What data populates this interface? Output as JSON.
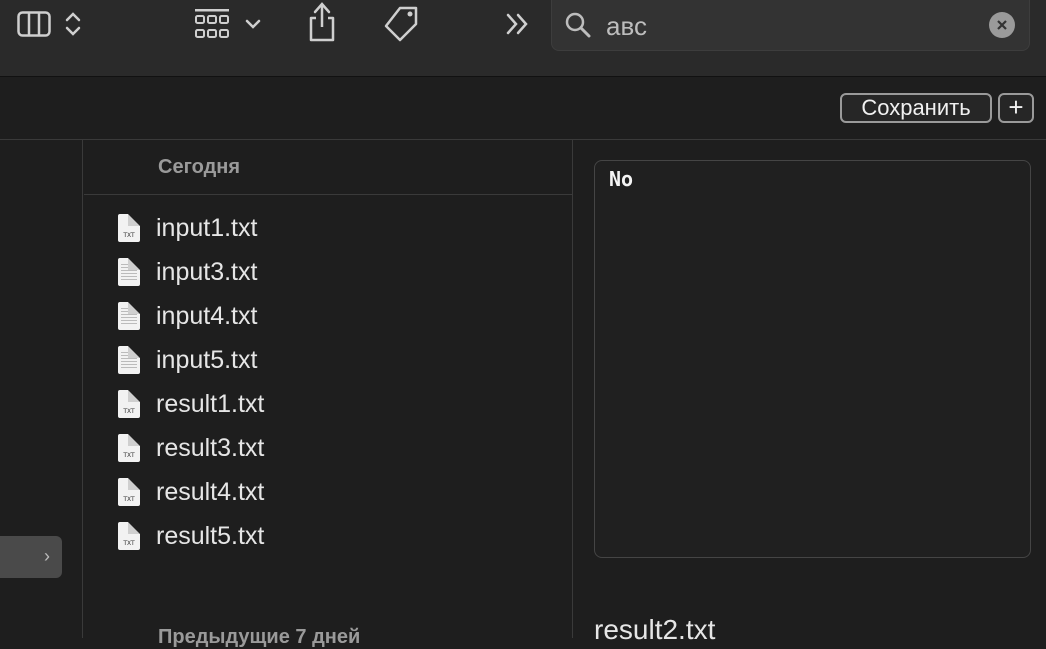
{
  "toolbar": {
    "icons": [
      "columns-view-icon",
      "up-down-chevron-icon",
      "grid-view-icon",
      "chevron-down-icon",
      "share-icon",
      "tag-icon",
      "more-chevrons-icon"
    ]
  },
  "search": {
    "value": "авс",
    "icon": "search-icon",
    "clear_icon": "clear-icon"
  },
  "actions": {
    "save_label": "Сохранить",
    "add_label": "+"
  },
  "sidebar": {
    "selected_chevron": "›"
  },
  "file_list": {
    "section_today": "Сегодня",
    "section_prev": "Предыдущие 7 дней",
    "files": [
      {
        "name": "input1.txt",
        "icon": "txt"
      },
      {
        "name": "input3.txt",
        "icon": "doc"
      },
      {
        "name": "input4.txt",
        "icon": "doc"
      },
      {
        "name": "input5.txt",
        "icon": "doc"
      },
      {
        "name": "result1.txt",
        "icon": "txt"
      },
      {
        "name": "result3.txt",
        "icon": "txt"
      },
      {
        "name": "result4.txt",
        "icon": "txt"
      },
      {
        "name": "result5.txt",
        "icon": "txt"
      }
    ],
    "txt_badge": "TXT"
  },
  "preview": {
    "content": "No",
    "file_name": "result2.txt"
  },
  "colors": {
    "background": "#1e1e1e",
    "toolbar": "#2a2a2a",
    "selection": "#4a4a4a"
  }
}
